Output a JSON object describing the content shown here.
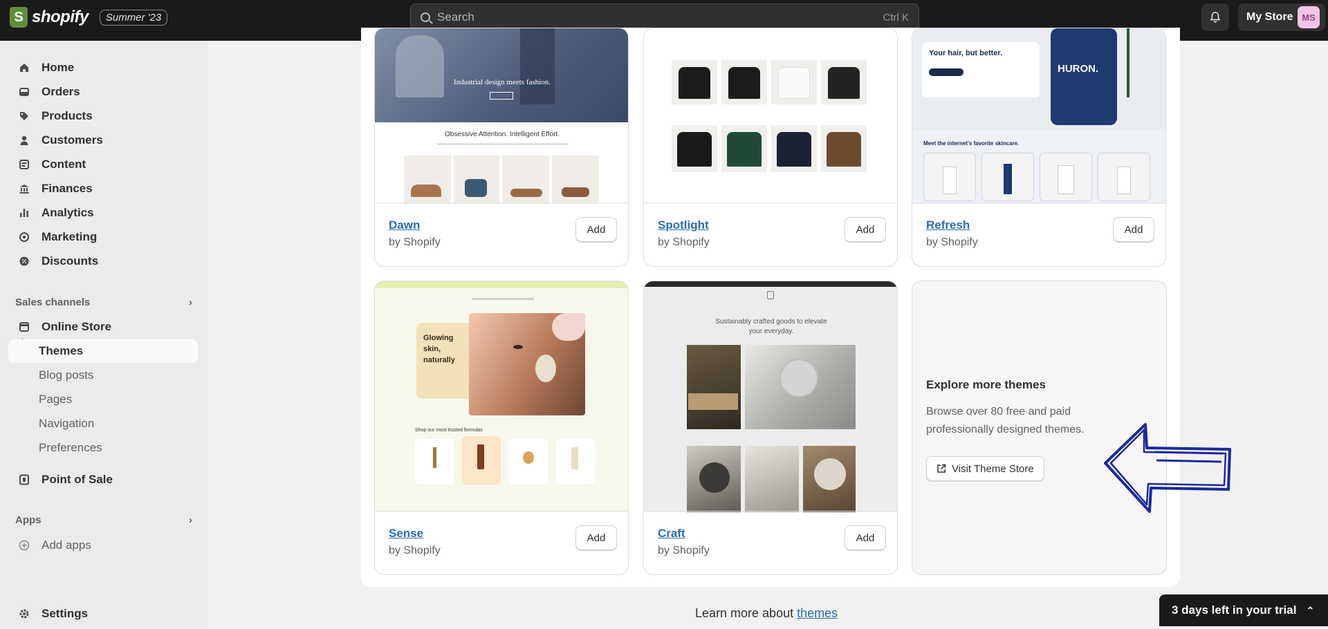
{
  "topbar": {
    "brand": "shopify",
    "edition": "Summer '23",
    "search_placeholder": "Search",
    "search_shortcut": "Ctrl K",
    "store_name": "My Store",
    "avatar_initials": "MS"
  },
  "sidebar": {
    "main_items": [
      {
        "label": "Home",
        "icon": "home-icon"
      },
      {
        "label": "Orders",
        "icon": "orders-icon"
      },
      {
        "label": "Products",
        "icon": "tag-icon"
      },
      {
        "label": "Customers",
        "icon": "person-icon"
      },
      {
        "label": "Content",
        "icon": "content-icon"
      },
      {
        "label": "Finances",
        "icon": "bank-icon"
      },
      {
        "label": "Analytics",
        "icon": "bar-chart-icon"
      },
      {
        "label": "Marketing",
        "icon": "target-icon"
      },
      {
        "label": "Discounts",
        "icon": "discount-icon"
      }
    ],
    "sales_channels_heading": "Sales channels",
    "online_store": "Online Store",
    "sub_items": [
      "Themes",
      "Blog posts",
      "Pages",
      "Navigation",
      "Preferences"
    ],
    "point_of_sale": "Point of Sale",
    "apps_heading": "Apps",
    "add_apps": "Add apps",
    "settings": "Settings"
  },
  "themes": [
    {
      "name": "Dawn",
      "by": "by Shopify",
      "add_label": "Add",
      "preview_headline": "Industrial design meets fashion.",
      "preview_subhead": "Obsessive Attention. Intelligent Effort."
    },
    {
      "name": "Spotlight",
      "by": "by Shopify",
      "add_label": "Add"
    },
    {
      "name": "Refresh",
      "by": "by Shopify",
      "add_label": "Add",
      "preview_headline": "Your hair, but better.",
      "preview_brand": "HURON.",
      "preview_section": "Meet the internet's favorite skincare."
    },
    {
      "name": "Sense",
      "by": "by Shopify",
      "add_label": "Add",
      "preview_headline": "Glowing skin, naturally",
      "preview_section": "Shop our most trusted formulas"
    },
    {
      "name": "Craft",
      "by": "by Shopify",
      "add_label": "Add",
      "preview_headline": "Sustainably crafted goods to elevate your everyday."
    }
  ],
  "explore": {
    "title": "Explore more themes",
    "description": "Browse over 80 free and paid professionally designed themes.",
    "button": "Visit Theme Store"
  },
  "learn_more": {
    "prefix": "Learn more about ",
    "link": "themes"
  },
  "trial_banner": "3 days left in your trial",
  "colors": {
    "accent_link": "#2a6db0",
    "annotation_arrow": "#1a2a9c",
    "topbar": "#1a1a1a"
  }
}
